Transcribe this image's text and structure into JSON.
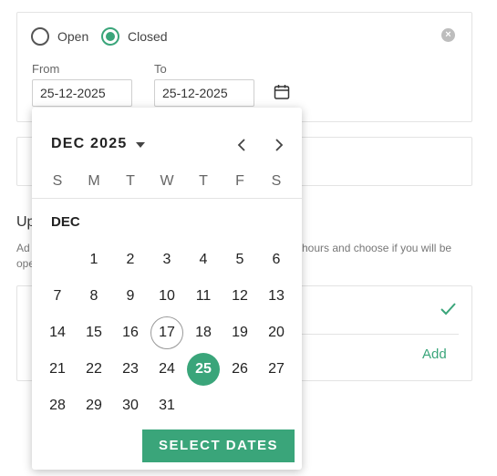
{
  "status": {
    "open_label": "Open",
    "closed_label": "Closed",
    "selected": "Closed"
  },
  "range": {
    "from_label": "From",
    "to_label": "To",
    "from_value": "25-12-2025",
    "to_value": "25-12-2025"
  },
  "section": {
    "heading_visible": "Up",
    "desc_line1_left": "Ad",
    "desc_line1_right": "hours and choose if you will be",
    "desc_line2_left": "ope"
  },
  "add_label": "Add",
  "colors": {
    "accent": "#3aa57a"
  },
  "icons": [
    "clear-icon",
    "calendar-icon",
    "check-icon",
    "chevron-left-icon",
    "chevron-right-icon",
    "caret-down-icon"
  ],
  "picker": {
    "month_title": "DEC 2025",
    "month_sub": "DEC",
    "weekdays": [
      "S",
      "M",
      "T",
      "W",
      "T",
      "F",
      "S"
    ],
    "weeks": [
      [
        "",
        "1",
        "2",
        "3",
        "4",
        "5",
        "6"
      ],
      [
        "7",
        "8",
        "9",
        "10",
        "11",
        "12",
        "13"
      ],
      [
        "14",
        "15",
        "16",
        "17",
        "18",
        "19",
        "20"
      ],
      [
        "21",
        "22",
        "23",
        "24",
        "25",
        "26",
        "27"
      ],
      [
        "28",
        "29",
        "30",
        "31",
        "",
        "",
        ""
      ]
    ],
    "today": "17",
    "selected": "25",
    "select_button": "SELECT DATES"
  }
}
